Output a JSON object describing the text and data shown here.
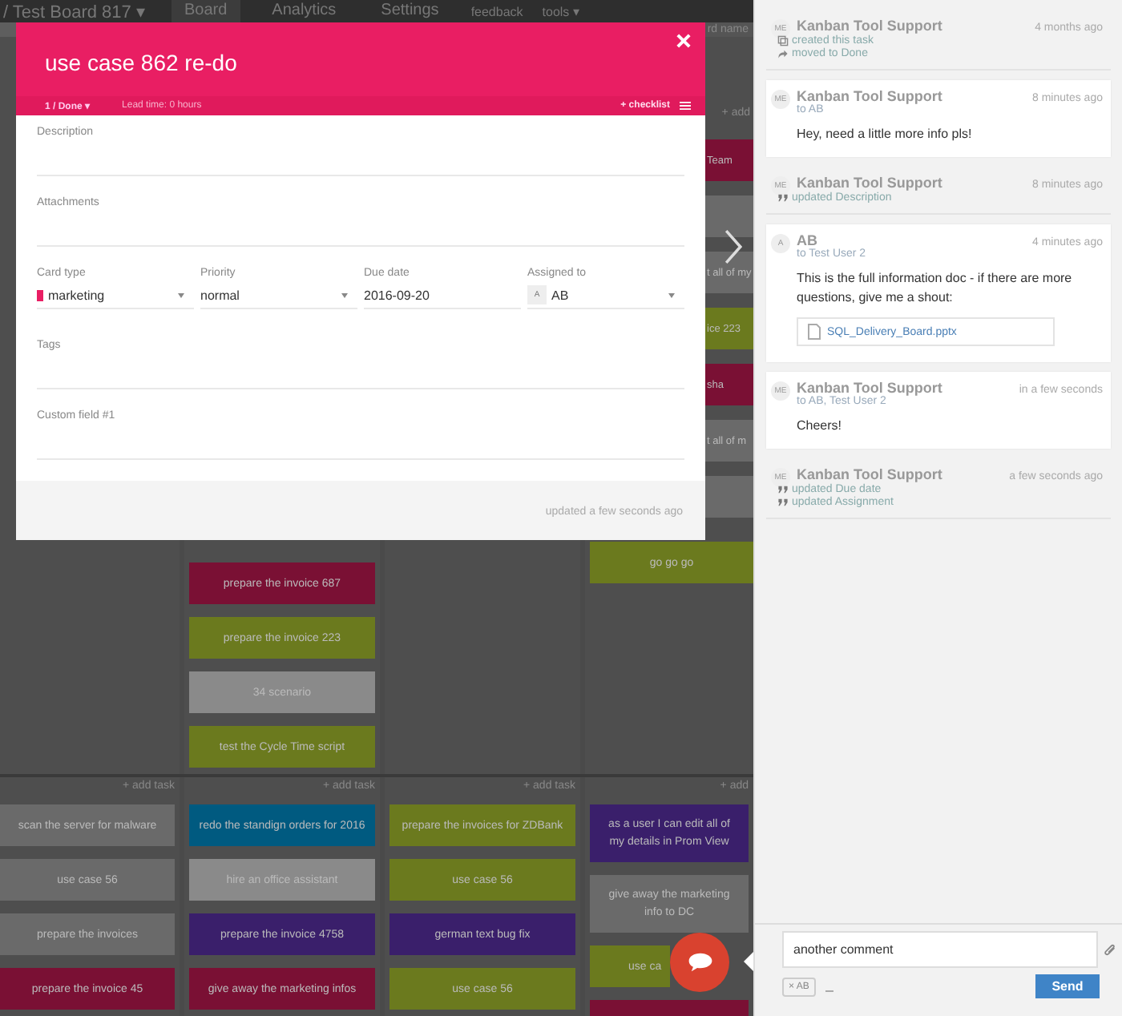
{
  "topbar": {
    "board_title": "/ Test Board 817 ▾",
    "tabs": [
      {
        "label": "Board",
        "selected": true
      },
      {
        "label": "Analytics",
        "selected": false
      },
      {
        "label": "Settings",
        "selected": false
      }
    ],
    "links": [
      "feedback",
      "tools ▾"
    ],
    "search_placeholder": "rd name"
  },
  "board": {
    "top_lane": {
      "add_label": "+ add",
      "columns": [
        {},
        {
          "cards": [
            {
              "text": "prepare the invoice 687",
              "color": "#7a1034"
            },
            {
              "text": "prepare the invoice 223",
              "color": "#6b7a1e"
            },
            {
              "text": "34 scenario",
              "color": "#8a8a8a"
            },
            {
              "text": "test the Cycle Time script",
              "color": "#6b7a1e"
            }
          ]
        },
        {},
        {
          "cards": [
            {
              "text": "Team",
              "color": "#7a1034",
              "partial": true
            },
            {
              "color": "#6a6a6a"
            },
            {
              "text": "t all of my",
              "color": "#6a6a6a",
              "partial": true
            },
            {
              "text": "ice 223",
              "color": "#6b7a1e",
              "partial": true
            },
            {
              "text": "sha",
              "color": "#7a1034",
              "partial": true
            },
            {
              "text": "t all of m",
              "color": "#6a6a6a",
              "partial": true
            },
            {
              "color": "#6a6a6a"
            },
            {
              "text": "go go go",
              "color": "#6b7a1e",
              "partial": false
            }
          ]
        }
      ]
    },
    "bottom_lane": {
      "columns": [
        {
          "add_label": "+ add task",
          "cards": [
            {
              "text": "scan the server for malware",
              "color": "#6a6a6a"
            },
            {
              "text": "use case 56",
              "color": "#6a6a6a"
            },
            {
              "text": "prepare the invoices",
              "color": "#6a6a6a"
            },
            {
              "text": "prepare the invoice 45",
              "color": "#7a1034"
            }
          ]
        },
        {
          "add_label": "+ add task",
          "cards": [
            {
              "text": "redo the standign orders for 2016",
              "color": "#005a80"
            },
            {
              "text": "hire an office assistant",
              "color": "#8a8a8a"
            },
            {
              "text": "prepare the invoice 4758",
              "color": "#3a1f6b"
            },
            {
              "text": "give away the marketing infos",
              "color": "#7a1034"
            }
          ]
        },
        {
          "add_label": "+ add task",
          "cards": [
            {
              "text": "prepare the invoices for ZDBank",
              "color": "#6b7a1e"
            },
            {
              "text": "use case 56",
              "color": "#6b7a1e"
            },
            {
              "text": "german text bug fix",
              "color": "#3a1f6b"
            },
            {
              "text": "use case 56",
              "color": "#6b7a1e"
            }
          ]
        },
        {
          "add_label": "+ add",
          "cards": [
            {
              "text": "as a user I can edit all of my details in Prom View",
              "color": "#3a1f6b"
            },
            {
              "text": "give away the marketing info to DC",
              "color": "#6a6a6a"
            },
            {
              "text": "use ca",
              "color": "#6b7a1e",
              "partial": true
            },
            {
              "color": "#7a1034"
            }
          ]
        }
      ]
    }
  },
  "card_dialog": {
    "title": "use case 862 re-do",
    "status": "1 / Done ▾",
    "lead_time": "Lead time: 0 hours",
    "checklist": "+ checklist",
    "fields_top": [
      {
        "label": "Description"
      },
      {
        "label": "Attachments"
      }
    ],
    "fields_row": [
      {
        "kind": "select",
        "label": "Card type",
        "value": "marketing",
        "color": "#e91e63"
      },
      {
        "kind": "select",
        "label": "Priority",
        "value": "normal"
      },
      {
        "kind": "date",
        "label": "Due date",
        "value": "2016-09-20"
      },
      {
        "kind": "user",
        "label": "Assigned to",
        "avatar": "A",
        "value": "AB"
      }
    ],
    "fields_bottom": [
      {
        "label": "Tags"
      },
      {
        "label": "Custom field #1"
      }
    ],
    "updated": "updated a few seconds ago"
  },
  "activity": [
    {
      "kind": "event",
      "avatar": "ME",
      "author": "Kanban Tool Support",
      "time": "4 months ago",
      "lines": [
        {
          "kind": "created",
          "text": "created this task"
        },
        {
          "kind": "moved",
          "text": "moved to Done"
        }
      ]
    },
    {
      "kind": "comment",
      "avatar": "ME",
      "author": "Kanban Tool Support",
      "time": "8 minutes ago",
      "to": "to AB",
      "body": "Hey, need a little more info pls!"
    },
    {
      "kind": "event",
      "avatar": "ME",
      "author": "Kanban Tool Support",
      "time": "8 minutes ago",
      "lines": [
        {
          "kind": "updated",
          "text": "updated Description"
        }
      ]
    },
    {
      "kind": "comment",
      "avatar": "A",
      "author": "AB",
      "time": "4 minutes ago",
      "to": "to Test User 2",
      "body": "This is the full information doc - if there are more questions, give me a shout:",
      "attachment": "SQL_Delivery_Board.pptx"
    },
    {
      "kind": "comment",
      "avatar": "ME",
      "author": "Kanban Tool Support",
      "time": "in a few seconds",
      "to": "to AB, Test User 2",
      "body": "Cheers!"
    },
    {
      "kind": "event",
      "avatar": "ME",
      "author": "Kanban Tool Support",
      "time": "a few seconds ago",
      "lines": [
        {
          "kind": "updated",
          "text": "updated Due date"
        },
        {
          "kind": "updated",
          "text": "updated Assignment"
        }
      ]
    }
  ],
  "composer": {
    "value": "another comment",
    "recipient": "× AB",
    "send": "Send"
  }
}
